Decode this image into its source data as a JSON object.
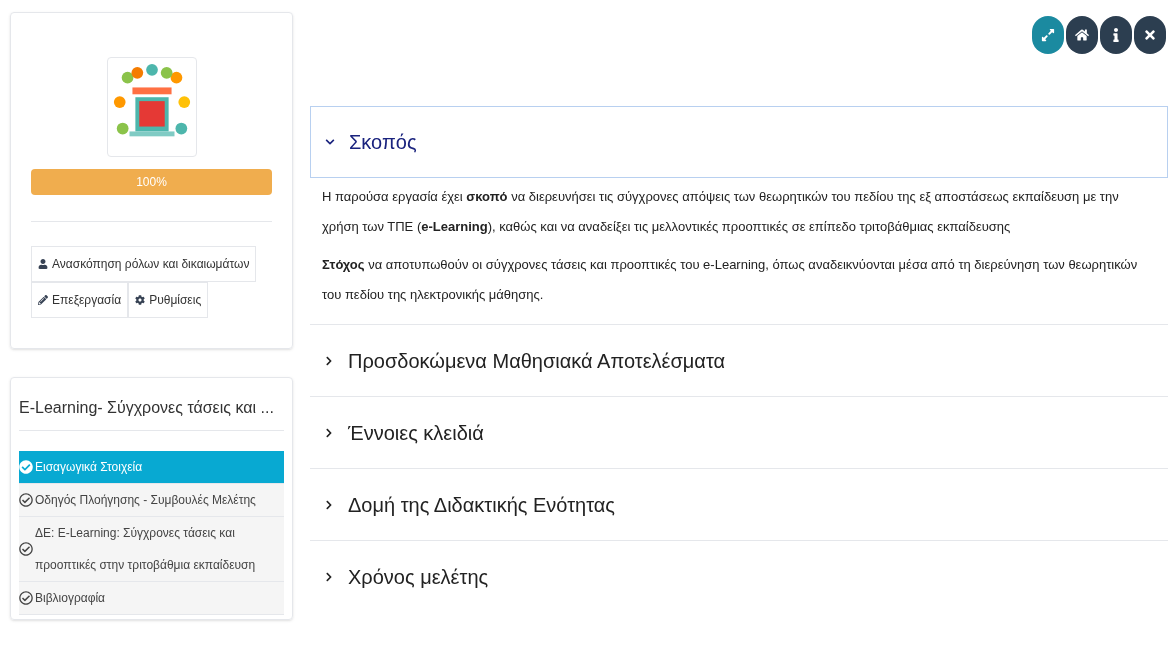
{
  "course_card": {
    "progress": {
      "label": "100%",
      "level": 1.0
    },
    "buttons": [
      {
        "label": "Ανασκόπηση ρόλων και δικαιωμάτων",
        "kind": "roles"
      },
      {
        "label": "Επεξεργασία",
        "kind": "edit"
      },
      {
        "label": "Ρυθμίσεις",
        "kind": "settings"
      }
    ]
  },
  "toc": {
    "title": "E-Learning- Σύγχρονες τάσεις και ...",
    "items": [
      {
        "label": "Εισαγωγικά Στοιχεία",
        "selected": true
      },
      {
        "label": "Οδηγός Πλοήγησης - Συμβουλές Μελέτης",
        "selected": false
      },
      {
        "label": "ΔΕ: E-Learning: Σύγχρονες τάσεις και προοπτικές στην τριτοβάθμια εκπαίδευση",
        "selected": false
      },
      {
        "label": "Βιβλιογραφία",
        "selected": false
      }
    ]
  },
  "toolbar": [
    {
      "kind": "fullscreen"
    },
    {
      "kind": "home"
    },
    {
      "kind": "info"
    },
    {
      "kind": "close"
    }
  ],
  "sections": [
    {
      "title": "Σκοπός",
      "expanded": true,
      "paragraphs": [
        "Η παρούσα εργασία έχει **σκοπό** να διερευνήσει τις σύγχρονες απόψεις των θεωρητικών του πεδίου της εξ αποστάσεως εκπαίδευση με την χρήση των ΤΠΕ (**e-Learning**), καθώς και να αναδείξει τις μελλοντικές προοπτικές σε επίπεδο τριτοβάθμιας εκπαίδευσης",
        "**Στόχος** να αποτυπωθούν οι σύγχρονες τάσεις και προοπτικές του e-Learning, όπως αναδεικνύονται μέσα από τη διερεύνηση των θεωρητικών του πεδίου της ηλεκτρονικής μάθησης."
      ]
    },
    {
      "title": "Προσδοκώμενα Μαθησιακά Αποτελέσματα",
      "expanded": false
    },
    {
      "title": "Έννοιες κλειδιά",
      "expanded": false
    },
    {
      "title": "Δομή της Διδακτικής Ενότητας",
      "expanded": false
    },
    {
      "title": "Χρόνος μελέτης",
      "expanded": false
    }
  ]
}
